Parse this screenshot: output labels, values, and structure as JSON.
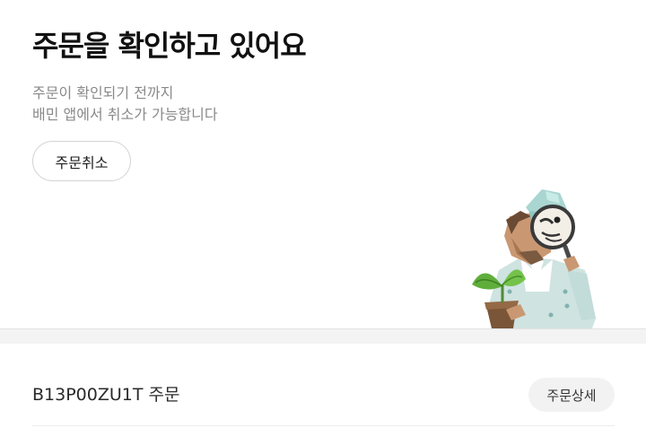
{
  "status": {
    "headline": "주문을 확인하고 있어요",
    "subtext_line1": "주문이 확인되기 전까지",
    "subtext_line2": "배민 앱에서 취소가 가능합니다",
    "cancel_label": "주문취소"
  },
  "order": {
    "id_label": "B13P00ZU1T 주문",
    "detail_label": "주문상세"
  },
  "colors": {
    "headline": "#111111",
    "subtext": "#8a8a8a",
    "divider": "#f3f3f3",
    "detail_button_bg": "#f2f2f2"
  },
  "illustration": "chef-with-magnifier-and-plant-icon"
}
